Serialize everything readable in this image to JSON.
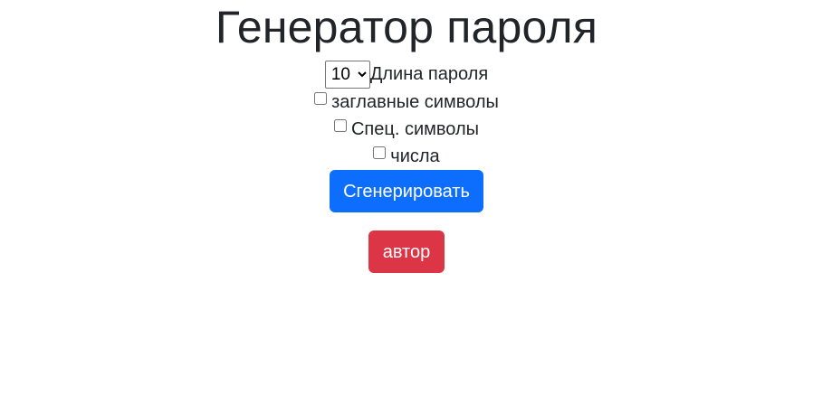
{
  "header": {
    "title": "Генератор пароля"
  },
  "form": {
    "length_select": {
      "selected": "10",
      "options": [
        "10"
      ]
    },
    "length_label": "Длина пароля",
    "checkboxes": [
      {
        "label": "заглавные символы",
        "checked": false
      },
      {
        "label": "Спец. символы",
        "checked": false
      },
      {
        "label": "числа",
        "checked": false
      }
    ],
    "generate_label": "Сгенерировать",
    "author_label": "автор"
  },
  "colors": {
    "primary": "#0d6efd",
    "danger": "#dc3545",
    "text": "#212529"
  }
}
